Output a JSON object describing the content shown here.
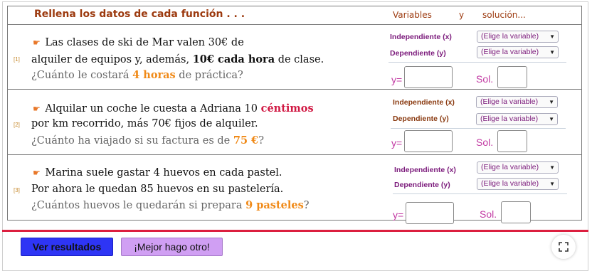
{
  "header": {
    "title": "Rellena los datos de cada función . . .",
    "variables": "Variables",
    "y": "y",
    "solucion": "solución..."
  },
  "problems": [
    {
      "number": "[1]",
      "l1a": "Las clases de ski de Mar valen 30€ de",
      "l2a": "alquiler de equipos y, además, ",
      "l2b": "10€ cada hora",
      "l2c": " de clase.",
      "l3a": "¿Cuánto le costará ",
      "l3b": "4 horas",
      "l3c": " de práctica?",
      "independent_label": "Independiente (x)",
      "dependent_label": "Dependiente (y)",
      "independent_select": "(Elige la variable)",
      "dependent_select": "(Elige la variable)",
      "y_label": "y=",
      "sol_label": "Sol."
    },
    {
      "number": "[2]",
      "l1a": "Alquilar un coche le cuesta a Adriana 10 ",
      "l1b": "céntimos",
      "l2a": "por km recorrido, más 70€ fijos de alquiler.",
      "l3a": "¿Cuánto ha viajado si su factura es de ",
      "l3b": "75 €",
      "l3c": "?",
      "independent_label": "Independiente (x)",
      "dependent_label": "Dependiente (y)",
      "independent_select": "(Elige la variable)",
      "dependent_select": "(Elige la variable)",
      "y_label": "y=",
      "sol_label": "Sol."
    },
    {
      "number": "[3]",
      "l1a": "Marina suele gastar 4 huevos en cada pastel.",
      "l2a": "Por ahora le quedan 85 huevos en su pastelería.",
      "l3a": "¿Cuántos huevos le quedarán si prepara ",
      "l3b": "9 pasteles",
      "l3c": "?",
      "independent_label": "Independiente (x)",
      "dependent_label": "Dependiente (y)",
      "independent_select": "(Elige la variable)",
      "dependent_select": "(Elige la variable)",
      "y_label": "y=",
      "sol_label": "Sol."
    }
  ],
  "buttons": {
    "check": "Ver resultados",
    "another": "¡Mejor hago otro!"
  },
  "icons": {
    "pointer": "☛",
    "arrow": "▼",
    "fullscreen": "fullscreen-icon"
  },
  "colors": {
    "accent_red": "#dc1f3f",
    "check_button": "#2e35f5",
    "another_button": "#d09ff3",
    "title": "#9c3a0f"
  }
}
